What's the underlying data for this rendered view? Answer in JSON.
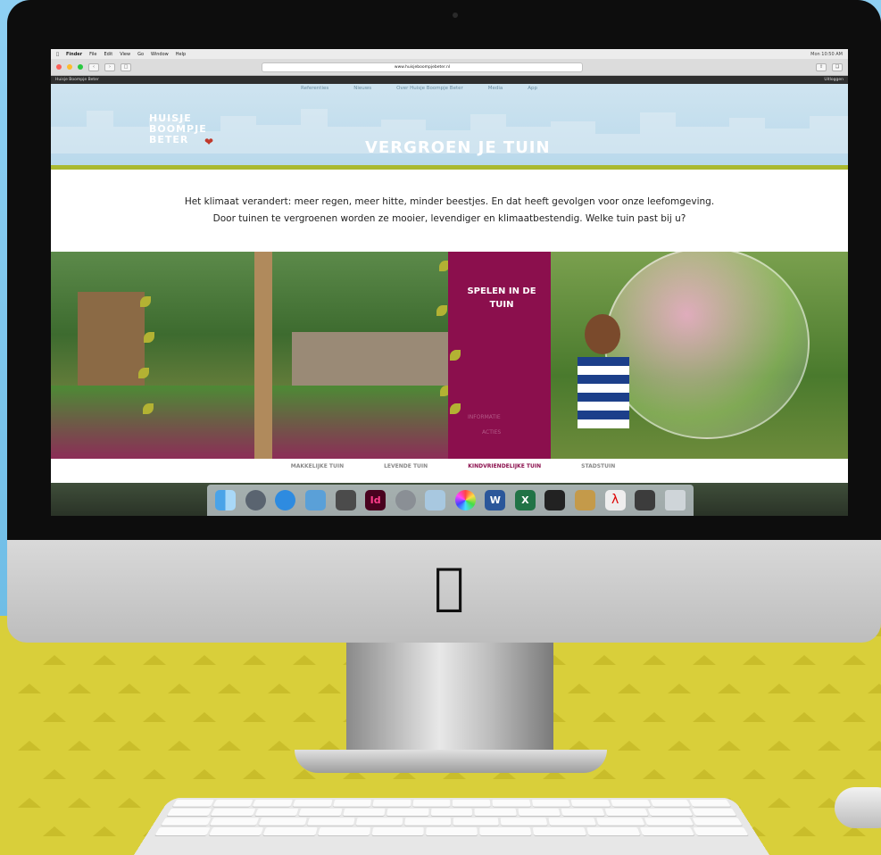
{
  "colors": {
    "brand_magenta": "#8b0f4d",
    "brand_green": "#aab92f",
    "header_blue": "#b9d9eb",
    "background_blue": "#7fc3ea",
    "background_yellow": "#d9cf3a"
  },
  "menubar": {
    "items": [
      "Finder",
      "File",
      "Edit",
      "View",
      "Go",
      "Window",
      "Help"
    ],
    "clock": "Mon 10:50 AM"
  },
  "browser": {
    "url": "www.huisjeboompjebeter.nl"
  },
  "bookmarks": {
    "site_label": "Huisje Boompje Beter",
    "logout": "Uitloggen"
  },
  "site": {
    "nav": [
      "Referenties",
      "Nieuws",
      "Over Huisje Boompje Beter",
      "Media",
      "App"
    ],
    "logo_lines": [
      "HUISJE",
      "BOOMPJE",
      "BETER"
    ],
    "title": "VERGROEN JE TUIN",
    "intro_line1": "Het klimaat verandert: meer regen, meer hitte, minder beestjes. En dat heeft gevolgen voor onze leefomgeving.",
    "intro_line2": "Door tuinen te vergroenen worden ze mooier, levendiger en klimaatbestendig. Welke tuin past bij u?",
    "panel_title": "SPELEN IN DE TUIN",
    "panel_link1": "INFORMATIE",
    "panel_link2": "ACTIES",
    "tabs": [
      "MAKKELIJKE TUIN",
      "LEVENDE TUIN",
      "KINDVRIENDELIJKE TUIN",
      "STADSTUIN"
    ],
    "active_tab": "KINDVRIENDELIJKE TUIN"
  },
  "dock": {
    "apps": [
      "finder-icon",
      "launchpad-icon",
      "safari-icon",
      "preview-icon",
      "notes-icon",
      "indesign-icon",
      "system-preferences-icon",
      "photos-icon",
      "color-icon",
      "word-icon",
      "excel-icon",
      "scanner-icon",
      "folder-icon",
      "acrobat-icon",
      "image-capture-icon",
      "trash-icon"
    ],
    "indesign_label": "Id",
    "word_label": "W",
    "excel_label": "X"
  }
}
